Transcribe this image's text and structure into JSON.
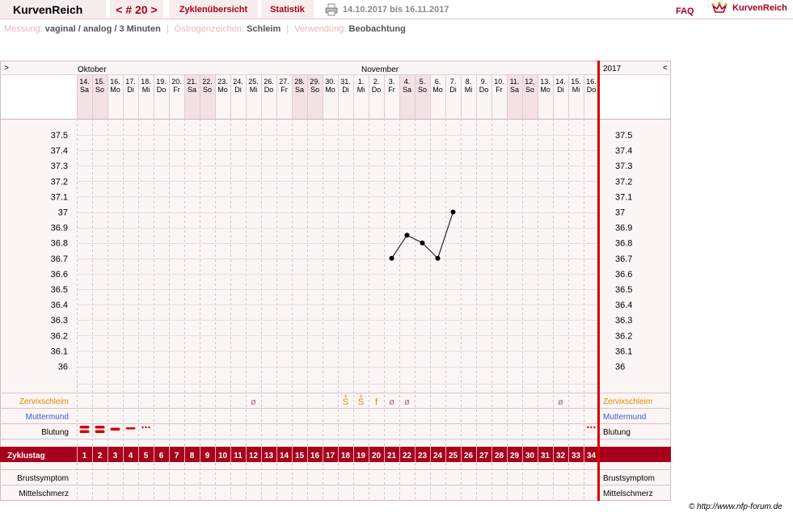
{
  "topbar": {
    "brand": "KurvenReich",
    "cycle_nav": "< # 20 >",
    "tab_overview": "Zyklenübersicht",
    "tab_stats": "Statistik",
    "date_range": "14.10.2017 bis 16.11.2017",
    "faq": "FAQ",
    "logo_text": "KurvenReich"
  },
  "meta": {
    "measure_label": "Messung:",
    "measure_value": "vaginal / analog / 3 Minuten",
    "estrogen_label": "Östrogenzeichen:",
    "estrogen_value": "Schleim",
    "usage_label": "Verwendung:",
    "usage_value": "Beobachtung"
  },
  "colors": {
    "accent": "#a8001c",
    "weekend": "#f3e1e3",
    "grid_bg": "#fbf5f5",
    "orange": "#e08a00",
    "blue": "#3a5ed0",
    "muted_symbol": "#a0786a"
  },
  "chart": {
    "nav_left": ">",
    "nav_right": "<",
    "months": [
      {
        "label": "Oktober",
        "start": 0
      },
      {
        "label": "November",
        "start": 18
      }
    ],
    "year": "2017",
    "days": [
      {
        "d": "14.",
        "w": "Sa"
      },
      {
        "d": "15.",
        "w": "So"
      },
      {
        "d": "16.",
        "w": "Mo"
      },
      {
        "d": "17.",
        "w": "Di"
      },
      {
        "d": "18.",
        "w": "Mi"
      },
      {
        "d": "19.",
        "w": "Do"
      },
      {
        "d": "20.",
        "w": "Fr"
      },
      {
        "d": "21.",
        "w": "Sa"
      },
      {
        "d": "22.",
        "w": "So"
      },
      {
        "d": "23.",
        "w": "Mo"
      },
      {
        "d": "24.",
        "w": "Di"
      },
      {
        "d": "25.",
        "w": "Mi"
      },
      {
        "d": "26.",
        "w": "Do"
      },
      {
        "d": "27.",
        "w": "Fr"
      },
      {
        "d": "28.",
        "w": "Sa"
      },
      {
        "d": "29.",
        "w": "So"
      },
      {
        "d": "30.",
        "w": "Mo"
      },
      {
        "d": "31.",
        "w": "Di"
      },
      {
        "d": "1.",
        "w": "Mi"
      },
      {
        "d": "2.",
        "w": "Do"
      },
      {
        "d": "3.",
        "w": "Fr"
      },
      {
        "d": "4.",
        "w": "Sa"
      },
      {
        "d": "5.",
        "w": "So"
      },
      {
        "d": "6.",
        "w": "Mo"
      },
      {
        "d": "7.",
        "w": "Di"
      },
      {
        "d": "8.",
        "w": "Mi"
      },
      {
        "d": "9.",
        "w": "Do"
      },
      {
        "d": "10.",
        "w": "Fr"
      },
      {
        "d": "11.",
        "w": "Sa"
      },
      {
        "d": "12.",
        "w": "So"
      },
      {
        "d": "13.",
        "w": "Mo"
      },
      {
        "d": "14.",
        "w": "Di"
      },
      {
        "d": "15.",
        "w": "Mi"
      },
      {
        "d": "16.",
        "w": "Do"
      }
    ],
    "temp_ticks": [
      "37.5",
      "37.4",
      "37.3",
      "37.2",
      "37.1",
      "37",
      "36.9",
      "36.8",
      "36.7",
      "36.6",
      "36.5",
      "36.4",
      "36.3",
      "36.2",
      "36.1",
      "36"
    ],
    "rows": {
      "cervix": "Zervixschleim",
      "cervix_mouth": "Muttermund",
      "bleeding": "Blutung",
      "cycle_day": "Zyklustag",
      "breast": "Brustsymptom",
      "midpain": "Mittelschmerz"
    },
    "cervix_symbols": [
      {
        "day": 12,
        "sym": "ø",
        "kind": "muted"
      },
      {
        "day": 18,
        "sym": "S",
        "kind": "orange",
        "plus": true
      },
      {
        "day": 19,
        "sym": "S",
        "kind": "orange",
        "plus": true
      },
      {
        "day": 20,
        "sym": "f",
        "kind": "orange"
      },
      {
        "day": 21,
        "sym": "ø",
        "kind": "muted"
      },
      {
        "day": 22,
        "sym": "ø",
        "kind": "muted"
      },
      {
        "day": 32,
        "sym": "ø",
        "kind": "muted"
      }
    ],
    "bleeding": [
      {
        "day": 1,
        "level": "strong"
      },
      {
        "day": 2,
        "level": "strong"
      },
      {
        "day": 3,
        "level": "medium"
      },
      {
        "day": 4,
        "level": "light"
      },
      {
        "day": 5,
        "level": "spotting"
      },
      {
        "day": 34,
        "level": "spotting"
      }
    ]
  },
  "chart_data": {
    "type": "line",
    "x": [
      21,
      22,
      23,
      24,
      25
    ],
    "y": [
      36.7,
      36.85,
      36.8,
      36.7,
      37.0
    ],
    "xlabel": "Zyklustag",
    "ylabel": "",
    "ylim": [
      36.0,
      37.5
    ],
    "xlim": [
      1,
      34
    ]
  },
  "copyright": "© http://www.nfp-forum.de"
}
